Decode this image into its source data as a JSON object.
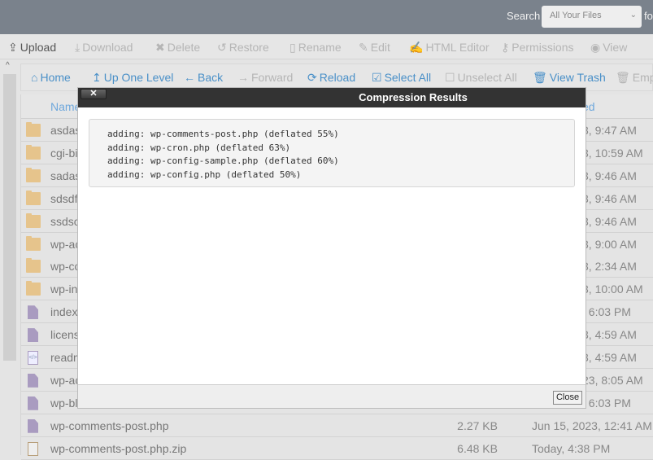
{
  "topbar": {
    "search_label": "Search",
    "search_scope": "All Your Files",
    "for_text": "fo"
  },
  "toolbar": [
    {
      "label": "Upload",
      "icon": "upload-icon",
      "glyph": "⇪",
      "active": true
    },
    {
      "label": "Download",
      "icon": "download-icon",
      "glyph": "⤓",
      "active": false
    },
    {
      "label": "Delete",
      "icon": "delete-icon",
      "glyph": "✖",
      "active": false
    },
    {
      "label": "Restore",
      "icon": "restore-icon",
      "glyph": "↺",
      "active": false
    },
    {
      "label": "Rename",
      "icon": "rename-icon",
      "glyph": "▯",
      "active": false
    },
    {
      "label": "Edit",
      "icon": "pencil-icon",
      "glyph": "✎",
      "active": false
    },
    {
      "label": "HTML Editor",
      "icon": "html-editor-icon",
      "glyph": "✍",
      "active": false
    },
    {
      "label": "Permissions",
      "icon": "key-icon",
      "glyph": "⚷",
      "active": false
    },
    {
      "label": "View",
      "icon": "eye-icon",
      "glyph": "◉",
      "active": false
    }
  ],
  "navbar": [
    {
      "label": "Home",
      "icon": "home-icon",
      "glyph": "⌂",
      "enabled": true
    },
    {
      "label": "Up One Level",
      "icon": "up-level-icon",
      "glyph": "↥",
      "enabled": true
    },
    {
      "label": "Back",
      "icon": "back-arrow-icon",
      "glyph": "←",
      "enabled": true
    },
    {
      "label": "Forward",
      "icon": "forward-arrow-icon",
      "glyph": "→",
      "enabled": false
    },
    {
      "label": "Reload",
      "icon": "reload-icon",
      "glyph": "⟳",
      "enabled": true
    },
    {
      "label": "Select All",
      "icon": "checkbox-checked-icon",
      "glyph": "☑",
      "enabled": true
    },
    {
      "label": "Unselect All",
      "icon": "checkbox-empty-icon",
      "glyph": "☐",
      "enabled": false
    },
    {
      "label": "View Trash",
      "icon": "trash-icon",
      "glyph": "🗑",
      "enabled": true
    },
    {
      "label": "Empt",
      "icon": "trash-icon",
      "glyph": "🗑",
      "enabled": false
    }
  ],
  "table": {
    "headers": {
      "name": "Name",
      "modified": "ed"
    },
    "rows": [
      {
        "type": "folder",
        "name": "asdas",
        "size": "",
        "modified": "3, 9:47 AM"
      },
      {
        "type": "folder",
        "name": "cgi-bi",
        "size": "",
        "modified": "3, 10:59 AM"
      },
      {
        "type": "folder",
        "name": "sadas",
        "size": "",
        "modified": "3, 9:46 AM"
      },
      {
        "type": "folder",
        "name": "sdsdf",
        "size": "",
        "modified": "3, 9:46 AM"
      },
      {
        "type": "folder",
        "name": "ssdsc",
        "size": "",
        "modified": "3, 9:46 AM"
      },
      {
        "type": "folder",
        "name": "wp-ac",
        "size": "",
        "modified": "3, 9:00 AM"
      },
      {
        "type": "folder",
        "name": "wp-co",
        "size": "",
        "modified": "3, 2:34 AM"
      },
      {
        "type": "folder",
        "name": "wp-in",
        "size": "",
        "modified": "3, 10:00 AM"
      },
      {
        "type": "doc",
        "name": "index",
        "size": "",
        "modified": ", 6:03 PM"
      },
      {
        "type": "doc",
        "name": "licens",
        "size": "",
        "modified": "3, 4:59 AM"
      },
      {
        "type": "code",
        "name": "readm",
        "size": "",
        "modified": "3, 4:59 AM"
      },
      {
        "type": "doc",
        "name": "wp-ac",
        "size": "",
        "modified": "23, 8:05 AM"
      },
      {
        "type": "doc",
        "name": "wp-bl",
        "size": "",
        "modified": ", 6:03 PM"
      },
      {
        "type": "doc",
        "name": "wp-comments-post.php",
        "size": "2.27 KB",
        "modified": "Jun 15, 2023, 12:41 AM",
        "full": true
      },
      {
        "type": "zip",
        "name": "wp-comments-post.php.zip",
        "size": "6.48 KB",
        "modified": "Today, 4:38 PM",
        "full": true
      }
    ]
  },
  "modal": {
    "title": "Compression Results",
    "close_x": "✕",
    "lines": [
      "adding: wp-comments-post.php (deflated 55%)",
      "adding: wp-cron.php (deflated 63%)",
      "adding: wp-config-sample.php (deflated 60%)",
      "adding: wp-config.php (deflated 50%)"
    ],
    "close_label": "Close"
  }
}
